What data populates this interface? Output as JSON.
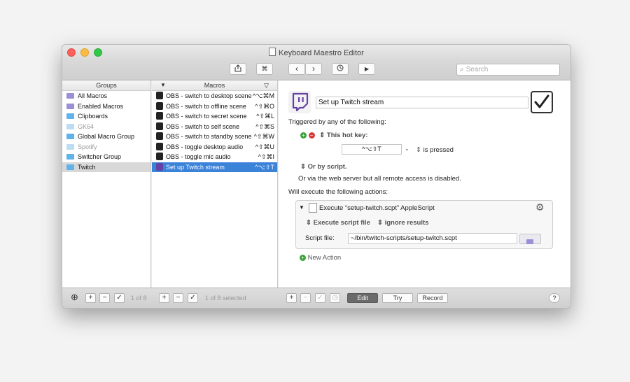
{
  "window": {
    "title": "Keyboard Maestro Editor"
  },
  "toolbar": {
    "share_icon": "share-icon",
    "cmd_glyph": "⌘",
    "back_glyph": "‹",
    "forward_glyph": "›",
    "clock_icon": "clock-icon",
    "run_glyph": "▶",
    "search_placeholder": "Search"
  },
  "groups": {
    "header": "Groups",
    "items": [
      {
        "label": "All Macros"
      },
      {
        "label": "Enabled Macros"
      },
      {
        "label": "Clipboards"
      },
      {
        "label": "GK64"
      },
      {
        "label": "Global Macro Group"
      },
      {
        "label": "Spotify"
      },
      {
        "label": "Switcher Group"
      },
      {
        "label": "Twitch"
      }
    ]
  },
  "macros": {
    "header": "Macros",
    "items": [
      {
        "label": "OBS - switch to desktop scene",
        "hotkey": "^⌥⌘M"
      },
      {
        "label": "OBS - switch to offline scene",
        "hotkey": "^⇧⌘O"
      },
      {
        "label": "OBS - switch to secret scene",
        "hotkey": "^⇧⌘L"
      },
      {
        "label": "OBS - switch to self scene",
        "hotkey": "^⇧⌘S"
      },
      {
        "label": "OBS - switch to standby scene",
        "hotkey": "^⇧⌘W"
      },
      {
        "label": "OBS - toggle desktop audio",
        "hotkey": "^⇧⌘U"
      },
      {
        "label": "OBS - toggle mic audio",
        "hotkey": "^⇧⌘I"
      },
      {
        "label": "Set up Twitch stream",
        "hotkey": "^⌥⇧T"
      }
    ]
  },
  "editor": {
    "macro_name": "Set up Twitch stream",
    "triggered_by": "Triggered by any of the following:",
    "hotkey_trigger": "This hot key:",
    "hotkey_value": "^⌥⇧T",
    "is_pressed": "is pressed",
    "or_by_script": "Or by script.",
    "web_server": "Or via the web server but all remote access is disabled.",
    "will_execute": "Will execute the following actions:",
    "action_title": "Execute “setup-twitch.scpt” AppleScript",
    "execute_script_file": "Execute script file",
    "ignore_results": "ignore results",
    "script_file_label": "Script file:",
    "script_file_value": "~/bin/twitch-scripts/setup-twitch.scpt",
    "new_action": "New Action"
  },
  "bottom": {
    "groups_count": "1 of 8",
    "macros_count": "1 of 8 selected",
    "edit": "Edit",
    "try": "Try",
    "record": "Record",
    "help": "?"
  },
  "colors": {
    "selection": "#3b82d9",
    "twitch": "#6441a4"
  }
}
